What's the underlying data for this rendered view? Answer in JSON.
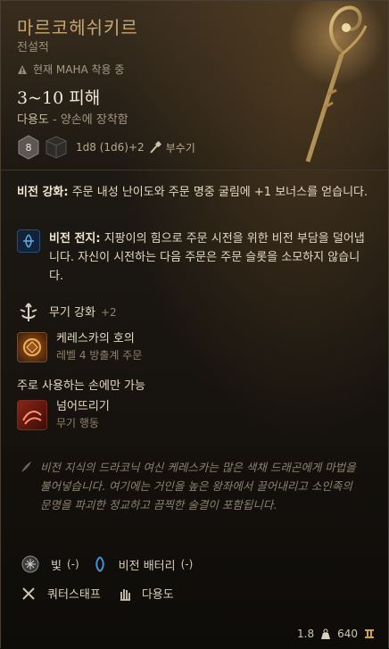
{
  "item": {
    "name": "마르코헤쉬키르",
    "rarity": "전설적",
    "equipped_notice": "현재 MAHA 착용 중",
    "damage": "3~10 피해",
    "handedness": "다용도",
    "handedness_detail": " - 양손에 장착함",
    "dice_badge": "8",
    "dice_formula": "1d8 (1d6)+2",
    "damage_type": "부수기"
  },
  "properties": {
    "arcane_enhancement_title": "비전 강화:",
    "arcane_enhancement_text": " 주문 내성 난이도와 주문 명중 굴림에 +1 보너스를 얻습니다.",
    "arcane_battery_title": "비전 전지:",
    "arcane_battery_text": " 지팡이의 힘으로 주문 시전을 위한 비전 부담을 덜어냅니다. 자신이 시전하는 다음 주문은 주문 슬롯을 소모하지 않습니다.",
    "weapon_enchant_label": "무기 강화",
    "weapon_enchant_value": "+2",
    "blessing_name": "케레스카의 호의",
    "blessing_sub": "레벨 4 방출계 주문",
    "main_hand_only": "주로 사용하는 손에만 가능",
    "topple_name": "넘어뜨리기",
    "topple_sub": "무기 행동"
  },
  "flavor_text": "비전 지식의 드라코닉 여신 케레스카는 많은 색채 드래곤에게 마법을 불어넣습니다. 여기에는 거인을 높은 왕좌에서 끌어내리고 소인족의 문명을 파괴한 정교하고 끔찍한 술결이 포함됩니다.",
  "tags": {
    "light_label": "빛",
    "light_value": "(-)",
    "battery_label": "비전 배터리",
    "battery_value": "(-)",
    "weapon_type": "쿼터스태프",
    "versatile": "다용도"
  },
  "footer": {
    "weight": "1.8",
    "value": "640"
  },
  "colors": {
    "title": "#c8a56c",
    "accent_blue": "#4a8fd0",
    "accent_red": "#b33a28",
    "gold": "#d0a050"
  }
}
